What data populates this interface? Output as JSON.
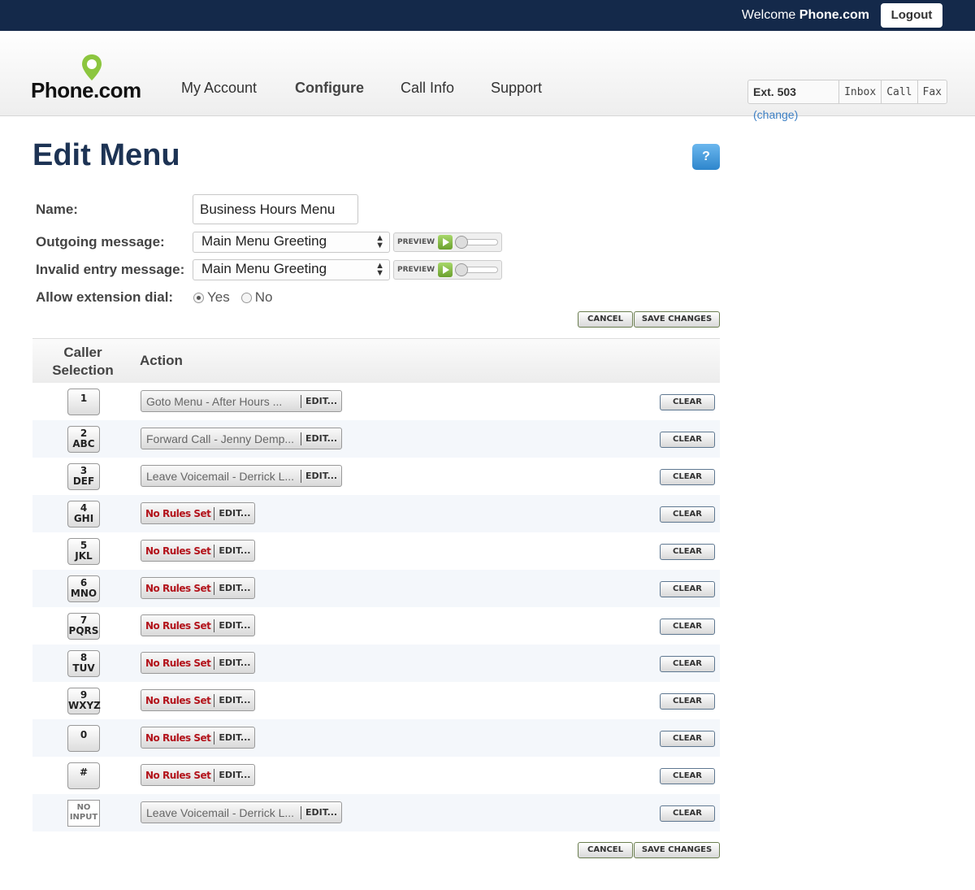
{
  "topbar": {
    "welcome_prefix": "Welcome",
    "welcome_user": "Phone.com",
    "logout_label": "Logout"
  },
  "header": {
    "logo_text": "Phone.com",
    "nav": [
      "My Account",
      "Configure",
      "Call Info",
      "Support"
    ],
    "ext_label": "Ext. 503",
    "ext_change": "(change)",
    "quick_links": [
      "Inbox",
      "Call",
      "Fax"
    ]
  },
  "page": {
    "title": "Edit Menu",
    "help_label": "?"
  },
  "form": {
    "name_label": "Name:",
    "name_value": "Business Hours Menu",
    "outgoing_label": "Outgoing message:",
    "outgoing_value": "Main Menu Greeting",
    "invalid_label": "Invalid entry message:",
    "invalid_value": "Main Menu Greeting",
    "preview_label": "PREVIEW",
    "allow_ext_label": "Allow extension dial:",
    "allow_ext_yes": "Yes",
    "allow_ext_no": "No",
    "allow_ext_selected": "Yes",
    "cancel_label": "CANCEL",
    "save_label": "SAVE CHANGES"
  },
  "table": {
    "col_caller": "Caller Selection",
    "col_action": "Action",
    "clear_label": "CLEAR",
    "edit_label": "EDIT...",
    "no_rules_label": "No Rules Set",
    "rows": [
      {
        "num": "1",
        "letters": "",
        "action": "Goto Menu - After Hours ..."
      },
      {
        "num": "2",
        "letters": "ABC",
        "action": "Forward Call - Jenny Demp..."
      },
      {
        "num": "3",
        "letters": "DEF",
        "action": "Leave Voicemail - Derrick L..."
      },
      {
        "num": "4",
        "letters": "GHI",
        "action": ""
      },
      {
        "num": "5",
        "letters": "JKL",
        "action": ""
      },
      {
        "num": "6",
        "letters": "MNO",
        "action": ""
      },
      {
        "num": "7",
        "letters": "PQRS",
        "action": ""
      },
      {
        "num": "8",
        "letters": "TUV",
        "action": ""
      },
      {
        "num": "9",
        "letters": "WXYZ",
        "action": ""
      },
      {
        "num": "0",
        "letters": "",
        "action": ""
      },
      {
        "num": "#",
        "letters": "",
        "action": ""
      },
      {
        "num": "NO",
        "letters": "INPUT",
        "action": "Leave Voicemail - Derrick L..."
      }
    ]
  },
  "colors": {
    "topbar": "#14294a",
    "title": "#1d3354",
    "no_rules": "#b3131b",
    "logo_pin": "#8cc63f"
  }
}
